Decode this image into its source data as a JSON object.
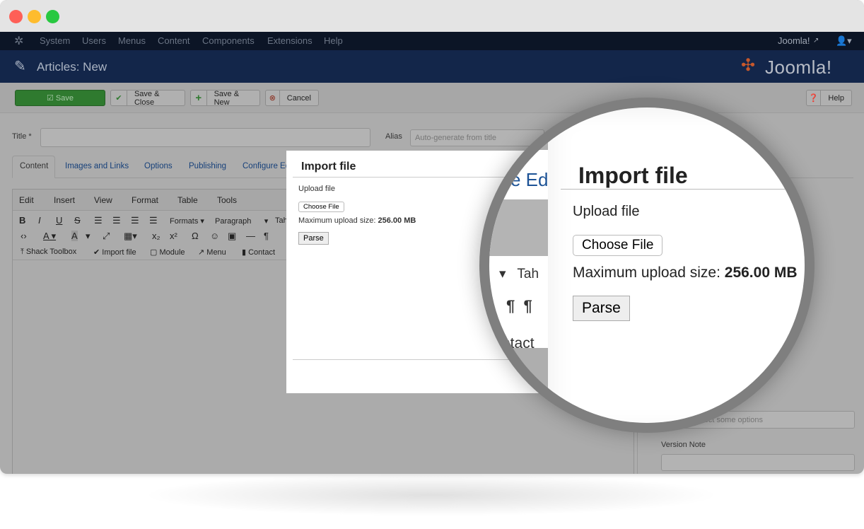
{
  "nav": {
    "items": [
      "System",
      "Users",
      "Menus",
      "Content",
      "Components",
      "Extensions",
      "Help"
    ],
    "site_link": "Joomla!"
  },
  "header": {
    "title": "Articles: New",
    "logo": "Joomla!"
  },
  "toolbar": {
    "save": "Save",
    "save_close": "Save & Close",
    "save_new": "Save & New",
    "cancel": "Cancel",
    "help": "Help"
  },
  "form": {
    "title_label": "Title *",
    "title_value": "",
    "alias_label": "Alias",
    "alias_placeholder": "Auto-generate from title"
  },
  "tabs": [
    "Content",
    "Images and Links",
    "Options",
    "Publishing",
    "Configure Ed"
  ],
  "editor": {
    "menus": [
      "Edit",
      "Insert",
      "View",
      "Format",
      "Table",
      "Tools"
    ],
    "formats": "Formats",
    "paragraph": "Paragraph",
    "font_partial": "Tah",
    "buttons": [
      "Shack Toolbox",
      "Import file",
      "Module",
      "Menu",
      "Contact"
    ]
  },
  "modal": {
    "title": "Import file",
    "upload_label": "Upload file",
    "choose_file": "Choose File",
    "max_label": "Maximum upload size:",
    "max_value": "256.00 MB",
    "parse": "Parse"
  },
  "magnifier": {
    "partial_tab": "e Ed",
    "partial_font": "Tah",
    "partial_contact": "ntact",
    "max_value_partial": "256.00 MB"
  },
  "sidebar": {
    "tags_placeholder": "Type or select some options",
    "version_note_label": "Version Note"
  },
  "colors": {
    "save_green": "#2f7a2f",
    "nav_bg": "#0c1526",
    "header_bg": "#13264a",
    "link": "#16407a"
  }
}
